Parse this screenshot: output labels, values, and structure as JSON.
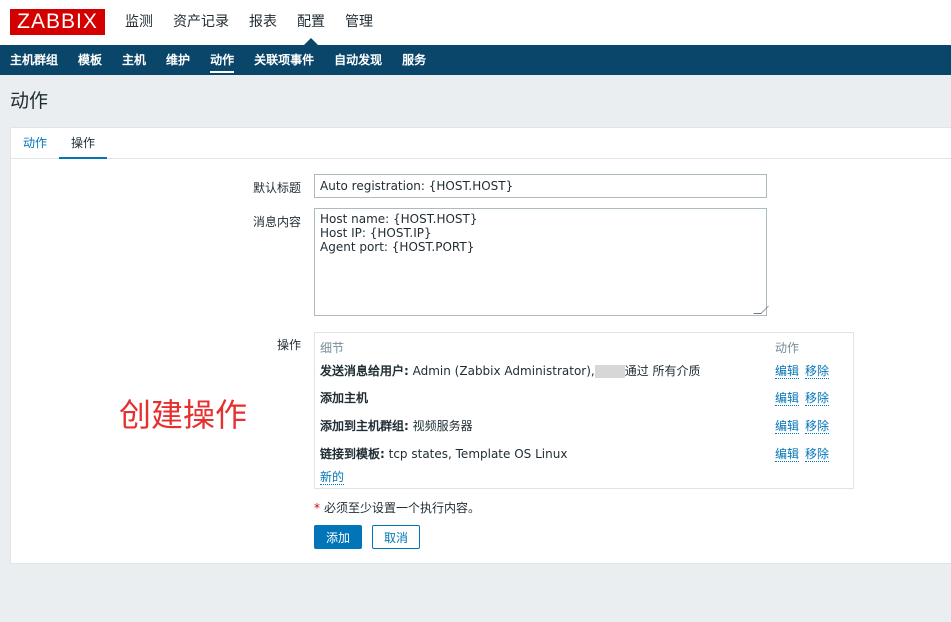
{
  "logo": {
    "text": "ZABBIX"
  },
  "main_nav": [
    "监测",
    "资产记录",
    "报表",
    "配置",
    "管理"
  ],
  "sub_nav": [
    "主机群组",
    "模板",
    "主机",
    "维护",
    "动作",
    "关联项事件",
    "自动发现",
    "服务"
  ],
  "page": {
    "title": "动作"
  },
  "tabs": [
    "动作",
    "操作"
  ],
  "form": {
    "default_subject_label": "默认标题",
    "default_subject_value": "Auto registration: {HOST.HOST}",
    "message_label": "消息内容",
    "message_lines": [
      "Host name: {HOST.HOST}",
      "Host IP: {HOST.IP}",
      "Agent port: {HOST.PORT}"
    ],
    "operations_label": "操作"
  },
  "operations": {
    "col_details": "细节",
    "col_action": "动作",
    "rows": [
      {
        "label": "发送消息给用户:",
        "text_before": " Admin (Zabbix Administrator),",
        "text_after": "通过 所有介质",
        "edit": "编辑",
        "remove": "移除"
      },
      {
        "label": "添加主机",
        "text_before": "",
        "text_after": "",
        "edit": "编辑",
        "remove": "移除"
      },
      {
        "label": "添加到主机群组:",
        "text_before": " 视频服务器",
        "text_after": "",
        "edit": "编辑",
        "remove": "移除"
      },
      {
        "label": "链接到模板:",
        "text_before": " tcp states, Template OS Linux",
        "text_after": "",
        "edit": "编辑",
        "remove": "移除"
      }
    ],
    "new_link": "新的"
  },
  "annotation": "创建操作",
  "note": {
    "star": "*",
    "text": "必须至少设置一个执行内容。"
  },
  "buttons": {
    "add": "添加",
    "cancel": "取消"
  },
  "colors": {
    "nav_bg": "#0a466a",
    "accent": "#0275b8",
    "logo_red": "#d40000",
    "annotation_red": "#e53030"
  }
}
